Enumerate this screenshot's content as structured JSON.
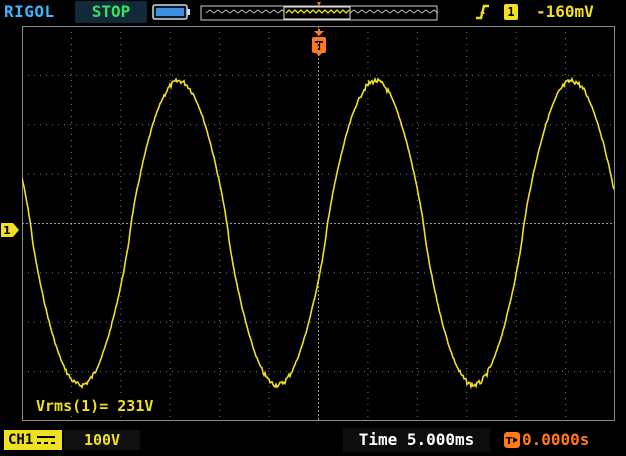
{
  "header": {
    "brand": "RIGOL",
    "run_status": "STOP",
    "trigger": {
      "source": "1",
      "level": "-160mV",
      "edge_icon": "rising-edge-icon"
    }
  },
  "channel": {
    "marker": "1",
    "badge": "CH1",
    "coupling_icon": "dc-coupling-icon",
    "scale": "100V"
  },
  "measurement": {
    "text": "Vrms(1)= 231V"
  },
  "timebase": {
    "scale": "Time 5.000ms",
    "offset": "0.0000s"
  },
  "colors": {
    "trace": "#f0e020",
    "run_status": "#2ee65a",
    "brand": "#39b8ff",
    "trigger_marker": "#ff7a1a"
  }
}
